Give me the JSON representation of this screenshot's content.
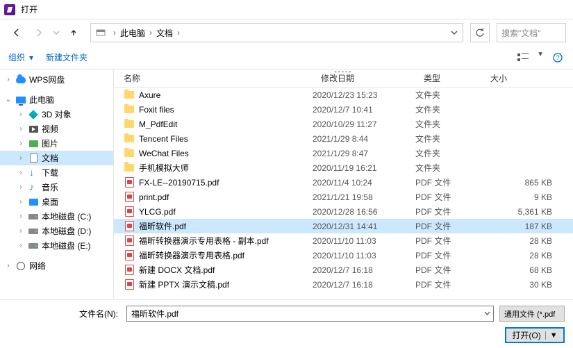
{
  "window": {
    "title": "打开"
  },
  "nav": {
    "breadcrumb": [
      "此电脑",
      "文档"
    ],
    "search_placeholder": "搜索\"文档\""
  },
  "toolbar": {
    "organize": "组织",
    "new_folder": "新建文件夹"
  },
  "sidebar": [
    {
      "chev": "",
      "icon": "cloud",
      "label": "WPS网盘",
      "indent": 0
    },
    {
      "chev": "",
      "icon": "monitor",
      "label": "此电脑",
      "indent": 0
    },
    {
      "chev": "",
      "icon": "3d",
      "label": "3D 对象",
      "indent": 1
    },
    {
      "chev": "",
      "icon": "video",
      "label": "视频",
      "indent": 1
    },
    {
      "chev": "",
      "icon": "pic",
      "label": "图片",
      "indent": 1
    },
    {
      "chev": "",
      "icon": "doc",
      "label": "文档",
      "indent": 1,
      "selected": true
    },
    {
      "chev": "",
      "icon": "down",
      "label": "下载",
      "indent": 1
    },
    {
      "chev": "",
      "icon": "music",
      "label": "音乐",
      "indent": 1
    },
    {
      "chev": "",
      "icon": "desk",
      "label": "桌面",
      "indent": 1
    },
    {
      "chev": "",
      "icon": "drive",
      "label": "本地磁盘 (C:)",
      "indent": 1
    },
    {
      "chev": "",
      "icon": "drive",
      "label": "本地磁盘 (D:)",
      "indent": 1
    },
    {
      "chev": "",
      "icon": "drive",
      "label": "本地磁盘 (E:)",
      "indent": 1
    },
    {
      "chev": "",
      "icon": "net",
      "label": "网络",
      "indent": 0
    }
  ],
  "columns": {
    "name": "名称",
    "date": "修改日期",
    "type": "类型",
    "size": "大小"
  },
  "files": [
    {
      "icon": "folder",
      "name": "Axure",
      "date": "2020/12/23 15:23",
      "type": "文件夹",
      "size": ""
    },
    {
      "icon": "folder",
      "name": "Foxit files",
      "date": "2020/12/7 10:41",
      "type": "文件夹",
      "size": ""
    },
    {
      "icon": "folder",
      "name": "M_PdfEdit",
      "date": "2020/10/29 11:27",
      "type": "文件夹",
      "size": ""
    },
    {
      "icon": "folder",
      "name": "Tencent Files",
      "date": "2021/1/29 8:44",
      "type": "文件夹",
      "size": ""
    },
    {
      "icon": "folder",
      "name": "WeChat Files",
      "date": "2021/1/29 8:47",
      "type": "文件夹",
      "size": ""
    },
    {
      "icon": "folder",
      "name": "手机模拟大师",
      "date": "2020/11/19 16:21",
      "type": "文件夹",
      "size": ""
    },
    {
      "icon": "pdf",
      "name": "FX-LE--20190715.pdf",
      "date": "2020/11/4 10:24",
      "type": "PDF 文件",
      "size": "865 KB"
    },
    {
      "icon": "pdf",
      "name": "print.pdf",
      "date": "2021/1/21 19:58",
      "type": "PDF 文件",
      "size": "9 KB"
    },
    {
      "icon": "pdf",
      "name": "YLCG.pdf",
      "date": "2020/12/28 16:56",
      "type": "PDF 文件",
      "size": "5,361 KB"
    },
    {
      "icon": "pdf",
      "name": "福昕软件.pdf",
      "date": "2020/12/31 14:41",
      "type": "PDF 文件",
      "size": "187 KB",
      "selected": true
    },
    {
      "icon": "pdf",
      "name": "福昕转换器演示专用表格 - 副本.pdf",
      "date": "2020/11/10 11:03",
      "type": "PDF 文件",
      "size": "28 KB"
    },
    {
      "icon": "pdf",
      "name": "福昕转换器演示专用表格.pdf",
      "date": "2020/11/10 11:03",
      "type": "PDF 文件",
      "size": "28 KB"
    },
    {
      "icon": "pdf",
      "name": "新建 DOCX 文档.pdf",
      "date": "2020/12/7 16:18",
      "type": "PDF 文件",
      "size": "68 KB"
    },
    {
      "icon": "pdf",
      "name": "新建 PPTX 演示文稿.pdf",
      "date": "2020/12/7 16:18",
      "type": "PDF 文件",
      "size": "30 KB"
    }
  ],
  "bottom": {
    "filename_label": "文件名(N):",
    "filename_value": "福昕软件.pdf",
    "filter": "通用文件 (*.pdf",
    "open": "打开(O)"
  }
}
